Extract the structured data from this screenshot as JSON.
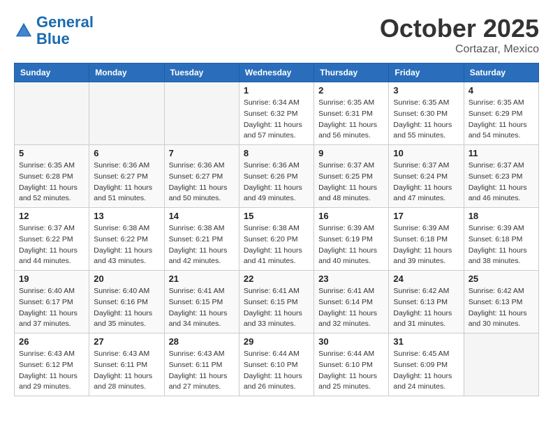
{
  "header": {
    "logo_line1": "General",
    "logo_line2": "Blue",
    "month": "October 2025",
    "location": "Cortazar, Mexico"
  },
  "weekdays": [
    "Sunday",
    "Monday",
    "Tuesday",
    "Wednesday",
    "Thursday",
    "Friday",
    "Saturday"
  ],
  "weeks": [
    [
      {
        "day": "",
        "info": ""
      },
      {
        "day": "",
        "info": ""
      },
      {
        "day": "",
        "info": ""
      },
      {
        "day": "1",
        "info": "Sunrise: 6:34 AM\nSunset: 6:32 PM\nDaylight: 11 hours\nand 57 minutes."
      },
      {
        "day": "2",
        "info": "Sunrise: 6:35 AM\nSunset: 6:31 PM\nDaylight: 11 hours\nand 56 minutes."
      },
      {
        "day": "3",
        "info": "Sunrise: 6:35 AM\nSunset: 6:30 PM\nDaylight: 11 hours\nand 55 minutes."
      },
      {
        "day": "4",
        "info": "Sunrise: 6:35 AM\nSunset: 6:29 PM\nDaylight: 11 hours\nand 54 minutes."
      }
    ],
    [
      {
        "day": "5",
        "info": "Sunrise: 6:35 AM\nSunset: 6:28 PM\nDaylight: 11 hours\nand 52 minutes."
      },
      {
        "day": "6",
        "info": "Sunrise: 6:36 AM\nSunset: 6:27 PM\nDaylight: 11 hours\nand 51 minutes."
      },
      {
        "day": "7",
        "info": "Sunrise: 6:36 AM\nSunset: 6:27 PM\nDaylight: 11 hours\nand 50 minutes."
      },
      {
        "day": "8",
        "info": "Sunrise: 6:36 AM\nSunset: 6:26 PM\nDaylight: 11 hours\nand 49 minutes."
      },
      {
        "day": "9",
        "info": "Sunrise: 6:37 AM\nSunset: 6:25 PM\nDaylight: 11 hours\nand 48 minutes."
      },
      {
        "day": "10",
        "info": "Sunrise: 6:37 AM\nSunset: 6:24 PM\nDaylight: 11 hours\nand 47 minutes."
      },
      {
        "day": "11",
        "info": "Sunrise: 6:37 AM\nSunset: 6:23 PM\nDaylight: 11 hours\nand 46 minutes."
      }
    ],
    [
      {
        "day": "12",
        "info": "Sunrise: 6:37 AM\nSunset: 6:22 PM\nDaylight: 11 hours\nand 44 minutes."
      },
      {
        "day": "13",
        "info": "Sunrise: 6:38 AM\nSunset: 6:22 PM\nDaylight: 11 hours\nand 43 minutes."
      },
      {
        "day": "14",
        "info": "Sunrise: 6:38 AM\nSunset: 6:21 PM\nDaylight: 11 hours\nand 42 minutes."
      },
      {
        "day": "15",
        "info": "Sunrise: 6:38 AM\nSunset: 6:20 PM\nDaylight: 11 hours\nand 41 minutes."
      },
      {
        "day": "16",
        "info": "Sunrise: 6:39 AM\nSunset: 6:19 PM\nDaylight: 11 hours\nand 40 minutes."
      },
      {
        "day": "17",
        "info": "Sunrise: 6:39 AM\nSunset: 6:18 PM\nDaylight: 11 hours\nand 39 minutes."
      },
      {
        "day": "18",
        "info": "Sunrise: 6:39 AM\nSunset: 6:18 PM\nDaylight: 11 hours\nand 38 minutes."
      }
    ],
    [
      {
        "day": "19",
        "info": "Sunrise: 6:40 AM\nSunset: 6:17 PM\nDaylight: 11 hours\nand 37 minutes."
      },
      {
        "day": "20",
        "info": "Sunrise: 6:40 AM\nSunset: 6:16 PM\nDaylight: 11 hours\nand 35 minutes."
      },
      {
        "day": "21",
        "info": "Sunrise: 6:41 AM\nSunset: 6:15 PM\nDaylight: 11 hours\nand 34 minutes."
      },
      {
        "day": "22",
        "info": "Sunrise: 6:41 AM\nSunset: 6:15 PM\nDaylight: 11 hours\nand 33 minutes."
      },
      {
        "day": "23",
        "info": "Sunrise: 6:41 AM\nSunset: 6:14 PM\nDaylight: 11 hours\nand 32 minutes."
      },
      {
        "day": "24",
        "info": "Sunrise: 6:42 AM\nSunset: 6:13 PM\nDaylight: 11 hours\nand 31 minutes."
      },
      {
        "day": "25",
        "info": "Sunrise: 6:42 AM\nSunset: 6:13 PM\nDaylight: 11 hours\nand 30 minutes."
      }
    ],
    [
      {
        "day": "26",
        "info": "Sunrise: 6:43 AM\nSunset: 6:12 PM\nDaylight: 11 hours\nand 29 minutes."
      },
      {
        "day": "27",
        "info": "Sunrise: 6:43 AM\nSunset: 6:11 PM\nDaylight: 11 hours\nand 28 minutes."
      },
      {
        "day": "28",
        "info": "Sunrise: 6:43 AM\nSunset: 6:11 PM\nDaylight: 11 hours\nand 27 minutes."
      },
      {
        "day": "29",
        "info": "Sunrise: 6:44 AM\nSunset: 6:10 PM\nDaylight: 11 hours\nand 26 minutes."
      },
      {
        "day": "30",
        "info": "Sunrise: 6:44 AM\nSunset: 6:10 PM\nDaylight: 11 hours\nand 25 minutes."
      },
      {
        "day": "31",
        "info": "Sunrise: 6:45 AM\nSunset: 6:09 PM\nDaylight: 11 hours\nand 24 minutes."
      },
      {
        "day": "",
        "info": ""
      }
    ]
  ]
}
